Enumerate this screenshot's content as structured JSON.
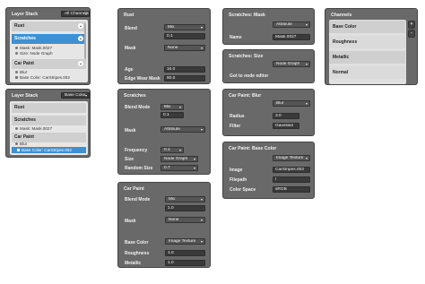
{
  "layer_stack_1": {
    "title": "Layer Stack",
    "channel": "All Channels",
    "items": [
      "Rust",
      "Scratches",
      "Car Paint"
    ],
    "scratches_children": [
      "Mask: Mask.0027",
      "Size: Node Graph"
    ],
    "car_paint_children": [
      "Blur",
      "Base Color: CarStripes.002"
    ]
  },
  "layer_stack_2": {
    "title": "Layer Stack",
    "channel": "Base Color",
    "items": [
      "Rust",
      "Scratches",
      "Car Paint"
    ],
    "scratches_children": [
      "Mask: Mask.0027"
    ],
    "car_paint_children": [
      "Blur",
      "Base Color: CarStripes.002"
    ]
  },
  "rust": {
    "title": "Rust",
    "blend_label": "Blend",
    "blend_value": "Mix",
    "blend_factor": "0.1",
    "mask_label": "Mask",
    "mask_value": "None",
    "age_label": "Age",
    "age_value": "10.0",
    "edge_label": "Edge Wear Mask",
    "edge_value": "80.0"
  },
  "scratches": {
    "title": "Scratches",
    "blend_label": "Blend Mode",
    "blend_value": "Mix",
    "blend_factor": "0.1",
    "mask_label": "Mask",
    "mask_value": "Attribute",
    "freq_label": "Frequency",
    "freq_value": "0.1",
    "size_label": "Size",
    "size_value": "Node Graph",
    "random_label": "Random Size",
    "random_value": "0.7"
  },
  "car_paint": {
    "title": "Car Paint",
    "blend_label": "Blend Mode",
    "blend_value": "Mix",
    "blend_factor": "1.0",
    "mask_label": "Mask",
    "mask_value": "None",
    "base_label": "Base Color",
    "base_value": "Image Texture",
    "rough_label": "Roughness",
    "rough_value": "1.0",
    "metal_label": "Metallic",
    "metal_value": "1.0"
  },
  "scratches_mask": {
    "title": "Scratches: Mask",
    "type_value": "Attribute",
    "name_label": "Name",
    "name_value": "Mask.0027"
  },
  "scratches_size": {
    "title": "Scratches: Size",
    "type_value": "Node Graph",
    "button": "Got to node editor"
  },
  "car_paint_blur": {
    "title": "Car Paint: Blur",
    "type_value": "Blur",
    "radius_label": "Radius",
    "radius_value": "3.0",
    "filter_label": "Filter",
    "filter_value": "Gaussian"
  },
  "car_paint_base": {
    "title": "Car Paint: Base Color",
    "type_value": "Image Texture",
    "image_label": "Image",
    "image_value": "CarStripes.002",
    "filepath_label": "Filepath",
    "filepath_value": "/",
    "colorspace_label": "Color Space",
    "colorspace_value": "sRGB"
  },
  "channels": {
    "title": "Channels",
    "items": [
      "Base Color",
      "Roughness",
      "Metallic",
      "Normal"
    ],
    "add": "+",
    "remove": "-"
  }
}
